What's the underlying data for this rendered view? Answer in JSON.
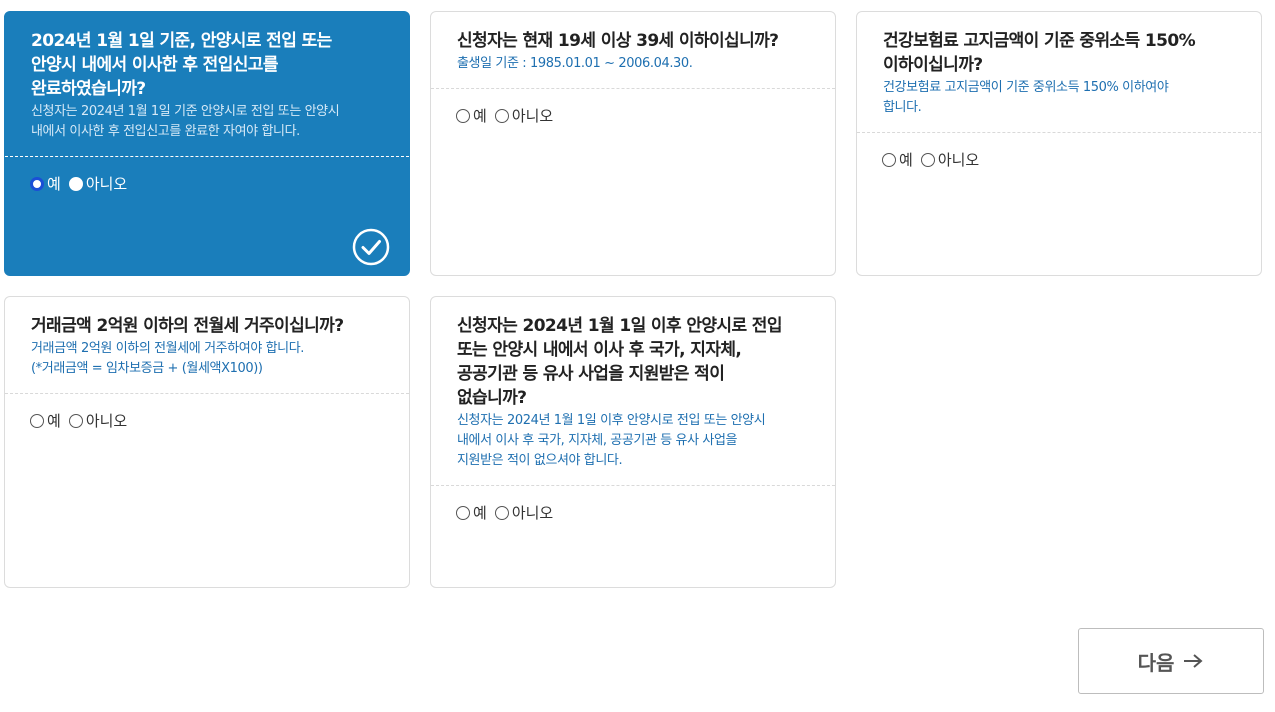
{
  "questions": [
    {
      "title": "2024년 1월 1일 기준, 안양시로 전입 또는\n안양시 내에서 이사한 후 전입신고를\n완료하였습니까?",
      "description": "신청자는 2024년 1월 1일 기준 안양시로 전입 또는 안양시\n내에서 이사한 후 전입신고를 완료한 자여야 합니다.",
      "yes": "예",
      "no": "아니오",
      "selected": "yes"
    },
    {
      "title": "신청자는 현재 19세 이상 39세 이하이십니까?",
      "description": "출생일 기준 : 1985.01.01 ~ 2006.04.30.",
      "yes": "예",
      "no": "아니오",
      "selected": ""
    },
    {
      "title": "건강보험료 고지금액이 기준 중위소득 150%\n이하이십니까?",
      "description": "건강보험료 고지금액이 기준 중위소득 150% 이하여야\n합니다.",
      "yes": "예",
      "no": "아니오",
      "selected": ""
    },
    {
      "title": "거래금액 2억원 이하의 전월세 거주이십니까?",
      "description": "거래금액 2억원 이하의 전월세에 거주하여야 합니다.\n(*거래금액 = 임차보증금 + (월세액X100))",
      "yes": "예",
      "no": "아니오",
      "selected": ""
    },
    {
      "title": "신청자는 2024년 1월 1일 이후 안양시로 전입\n또는 안양시 내에서 이사 후 국가, 지자체,\n공공기관 등 유사 사업을 지원받은 적이\n없습니까?",
      "description": "신청자는 2024년 1월 1일 이후 안양시로 전입 또는 안양시\n내에서 이사 후 국가, 지자체, 공공기관 등 유사 사업을\n지원받은 적이 없으셔야 합니다.",
      "yes": "예",
      "no": "아니오",
      "selected": ""
    }
  ],
  "next_button": {
    "label": "다음"
  },
  "icons": {
    "check": "check-circle-icon",
    "next_arrow": "arrow-right-icon"
  },
  "colors": {
    "selected_card": "#1a7ebb",
    "description_text": "#1e6fb0",
    "radio_selected": "#1a4fd6"
  }
}
